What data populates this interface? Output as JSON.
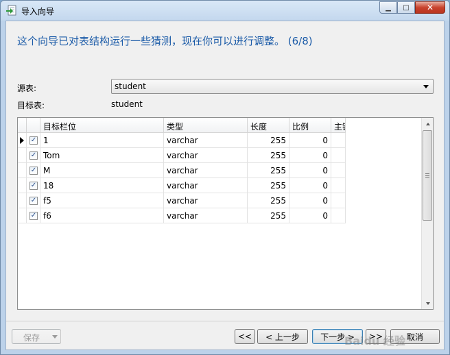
{
  "window": {
    "title": "导入向导"
  },
  "headline": "这个向导已对表结构运行一些猜测，现在你可以进行调整。 (6/8)",
  "source": {
    "label": "源表:",
    "value": "student"
  },
  "target": {
    "label": "目标表:",
    "value": "student"
  },
  "grid": {
    "columns": [
      "目标栏位",
      "类型",
      "长度",
      "比例",
      "主键"
    ],
    "rows": [
      {
        "checked": true,
        "name": "1",
        "type": "varchar",
        "length": "255",
        "scale": "0"
      },
      {
        "checked": true,
        "name": "Tom",
        "type": "varchar",
        "length": "255",
        "scale": "0"
      },
      {
        "checked": true,
        "name": "M",
        "type": "varchar",
        "length": "255",
        "scale": "0"
      },
      {
        "checked": true,
        "name": "18",
        "type": "varchar",
        "length": "255",
        "scale": "0"
      },
      {
        "checked": true,
        "name": "f5",
        "type": "varchar",
        "length": "255",
        "scale": "0"
      },
      {
        "checked": true,
        "name": "f6",
        "type": "varchar",
        "length": "255",
        "scale": "0"
      }
    ]
  },
  "buttons": {
    "save": "保存",
    "first": "<<",
    "prev": "< 上一步",
    "next": "下一步 >",
    "last": ">>",
    "cancel": "取消"
  },
  "watermark": "Baidu 经验",
  "colors": {
    "headline": "#1b5ba8",
    "accent_focus": "#3c7fb1"
  },
  "icons": {
    "app": "import-wizard-icon",
    "checkbox": "check-mark"
  }
}
